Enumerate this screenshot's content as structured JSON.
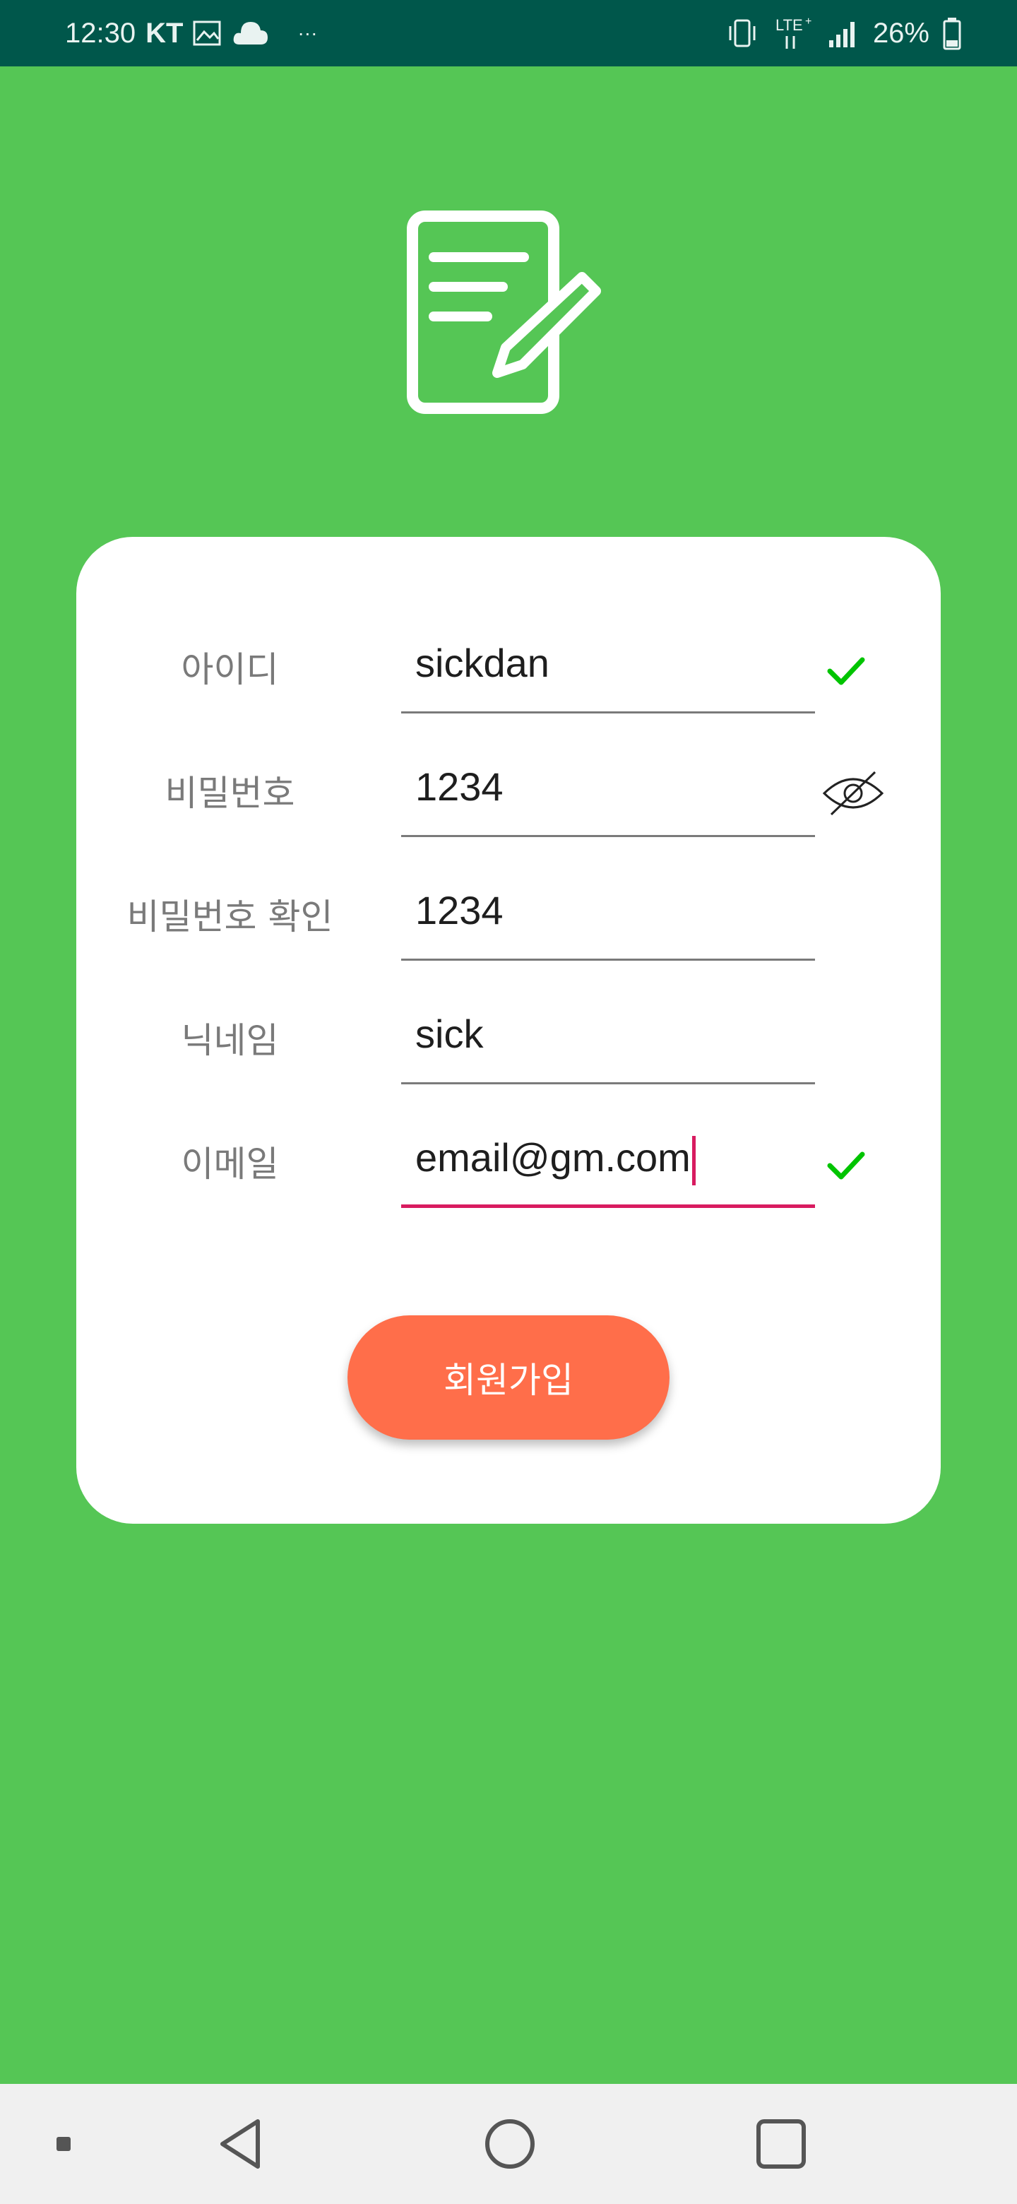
{
  "status_bar": {
    "time": "12:30",
    "carrier": "KT",
    "network": "LTE+",
    "battery": "26%"
  },
  "form": {
    "fields": [
      {
        "label": "아이디",
        "value": "sickdan",
        "status_icon": "check-icon"
      },
      {
        "label": "비밀번호",
        "value": "1234",
        "status_icon": "eye-off-icon"
      },
      {
        "label": "비밀번호 확인",
        "value": "1234"
      },
      {
        "label": "닉네임",
        "value": "sick"
      },
      {
        "label": "이메일",
        "value": "email@gm.com",
        "status_icon": "check-icon"
      }
    ],
    "submit_label": "회원가입"
  },
  "colors": {
    "background": "#55c655",
    "status_bar": "#00574b",
    "button": "#ff6e4a",
    "focus": "#d81b60",
    "check": "#00c400"
  }
}
